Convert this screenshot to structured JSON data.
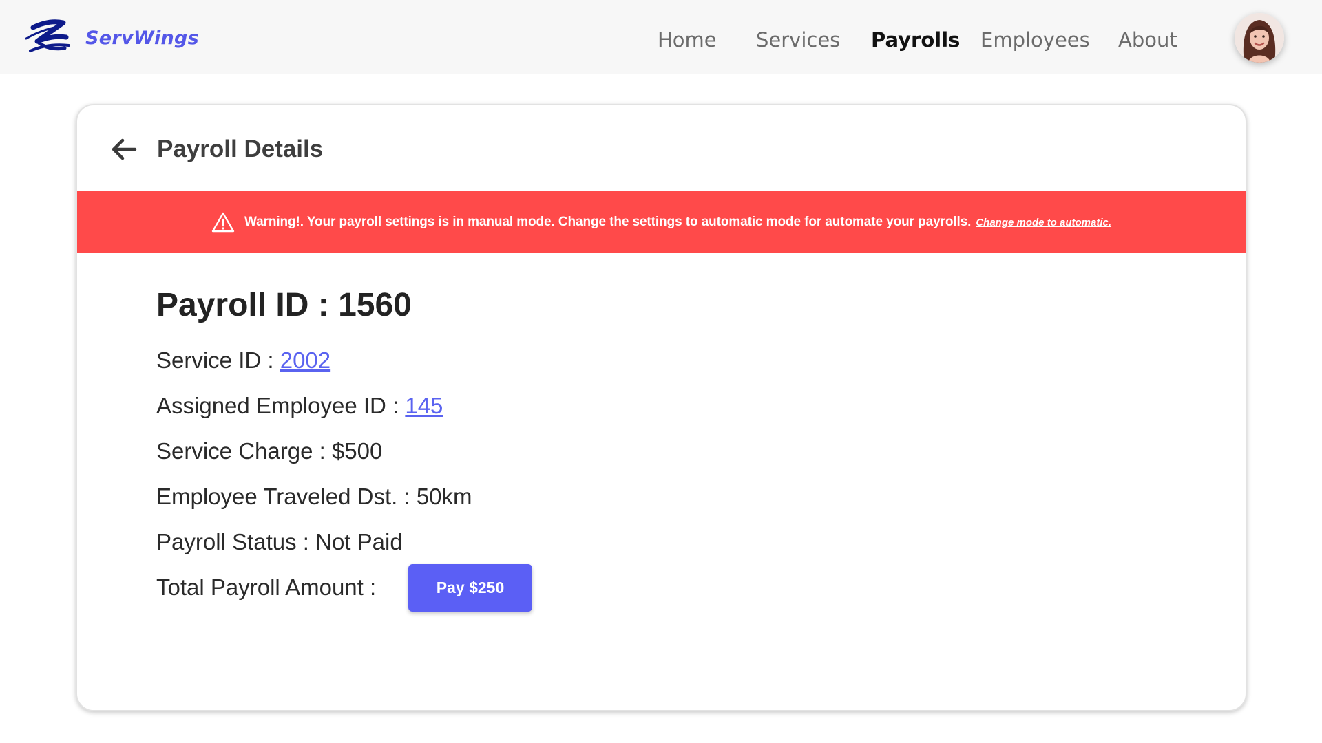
{
  "brand": {
    "name": "ServWings",
    "color": "#5457e8"
  },
  "nav": {
    "items": [
      {
        "label": "Home",
        "active": false
      },
      {
        "label": "Services",
        "active": false
      },
      {
        "label": "Payrolls",
        "active": true
      },
      {
        "label": "Employees",
        "active": false
      },
      {
        "label": "About",
        "active": false
      }
    ]
  },
  "user": {
    "avatar_icon": "user-avatar"
  },
  "card": {
    "back_icon": "arrow-left-icon",
    "title": "Payroll Details"
  },
  "warning": {
    "icon": "warning-triangle-icon",
    "text": "Warning!. Your payroll settings is in manual mode.  Change the settings to automatic mode for automate your payrolls.",
    "link": "Change mode to automatic.",
    "background": "#ff4a4a"
  },
  "payroll": {
    "id_label": "Payroll ID : ",
    "id": "1560",
    "service_id_label": "Service ID : ",
    "service_id": "2002",
    "employee_id_label": "Assigned Employee ID : ",
    "employee_id": "145",
    "service_charge_label": "Service Charge : ",
    "service_charge": "$500",
    "distance_label": "Employee Traveled Dst. : ",
    "distance": "50km",
    "status_label": "Payroll Status : ",
    "status": "Not Paid",
    "total_label": "Total Payroll Amount : ",
    "pay_button": "Pay $250",
    "button_color": "#5b5ff5",
    "link_color": "#5a63f0"
  }
}
